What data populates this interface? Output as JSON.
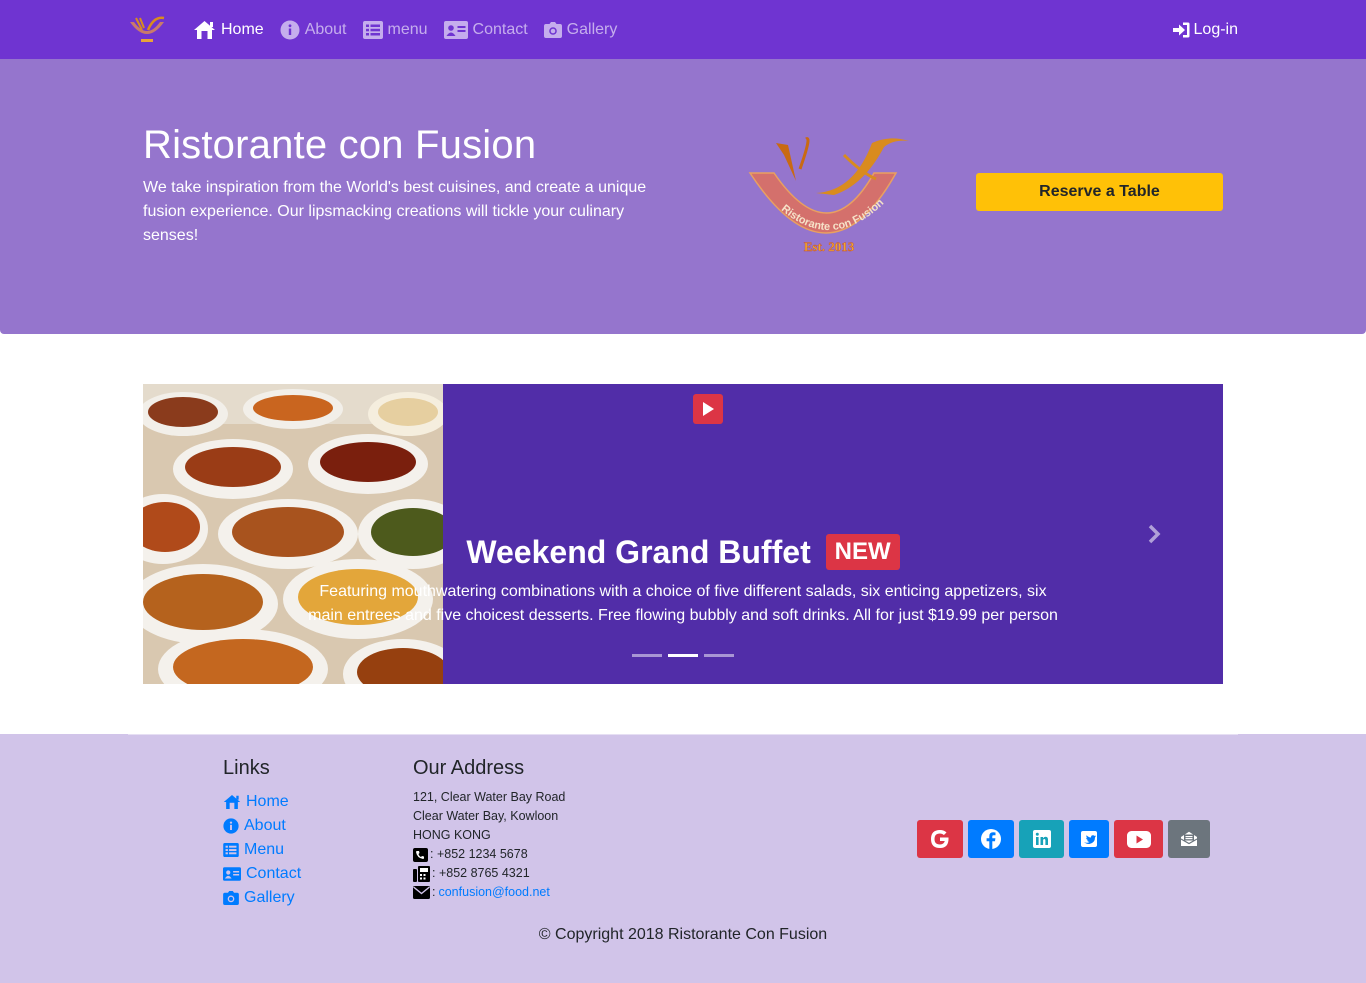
{
  "navbar": {
    "brand_logo": "restaurant-logo",
    "items": [
      {
        "label": "Home",
        "icon": "home-icon",
        "active": true
      },
      {
        "label": "About",
        "icon": "info-icon",
        "active": false
      },
      {
        "label": "menu",
        "icon": "list-icon",
        "active": false
      },
      {
        "label": "Contact",
        "icon": "address-card-icon",
        "active": false
      },
      {
        "label": "Gallery",
        "icon": "camera-icon",
        "active": false
      }
    ],
    "login_label": "Log-in"
  },
  "hero": {
    "title": "Ristorante con Fusion",
    "text": "We take inspiration from the World's best cuisines, and create a unique fusion experience. Our lipsmacking creations will tickle your culinary senses!",
    "reserve_label": "Reserve a Table",
    "logo_ring_text": "Ristorante con Fusion",
    "logo_est_text": "Est. 2013"
  },
  "carousel": {
    "slide_title": "Weekend Grand Buffet",
    "badge": "NEW",
    "slide_text": "Featuring mouthwatering combinations with a choice of five different salads, six enticing appetizers, six main entrees and five choicest desserts. Free flowing bubbly and soft drinks. All for just $19.99 per person",
    "indicator_count": 3,
    "active_index": 1
  },
  "footer": {
    "links_heading": "Links",
    "links": [
      {
        "label": "Home",
        "icon": "home-icon"
      },
      {
        "label": "About",
        "icon": "info-icon"
      },
      {
        "label": "Menu",
        "icon": "list-icon"
      },
      {
        "label": "Contact",
        "icon": "address-card-icon"
      },
      {
        "label": "Gallery",
        "icon": "camera-icon"
      }
    ],
    "address_heading": "Our Address",
    "address_lines": [
      "121, Clear Water Bay Road",
      "Clear Water Bay, Kowloon",
      "HONG KONG"
    ],
    "phone": ": +852 1234 5678",
    "fax": ": +852 8765 4321",
    "email_prefix": ":",
    "email": "confusion@food.net",
    "social": [
      {
        "name": "google-icon",
        "color": "#dc3545"
      },
      {
        "name": "facebook-icon",
        "color": "#007bff"
      },
      {
        "name": "linkedin-icon",
        "color": "#17a2b8"
      },
      {
        "name": "twitter-icon",
        "color": "#007bff"
      },
      {
        "name": "youtube-icon",
        "color": "#dc3545"
      },
      {
        "name": "mail-icon",
        "color": "#6c757d"
      }
    ],
    "copyright": "© Copyright 2018 Ristorante Con Fusion"
  },
  "colors": {
    "navbar": "#6f34d1",
    "jumbotron": "#9575cd",
    "carousel": "#512da8",
    "footer": "#d1c4e9",
    "warning": "#ffc107",
    "danger": "#dc3545",
    "primary": "#007bff"
  }
}
